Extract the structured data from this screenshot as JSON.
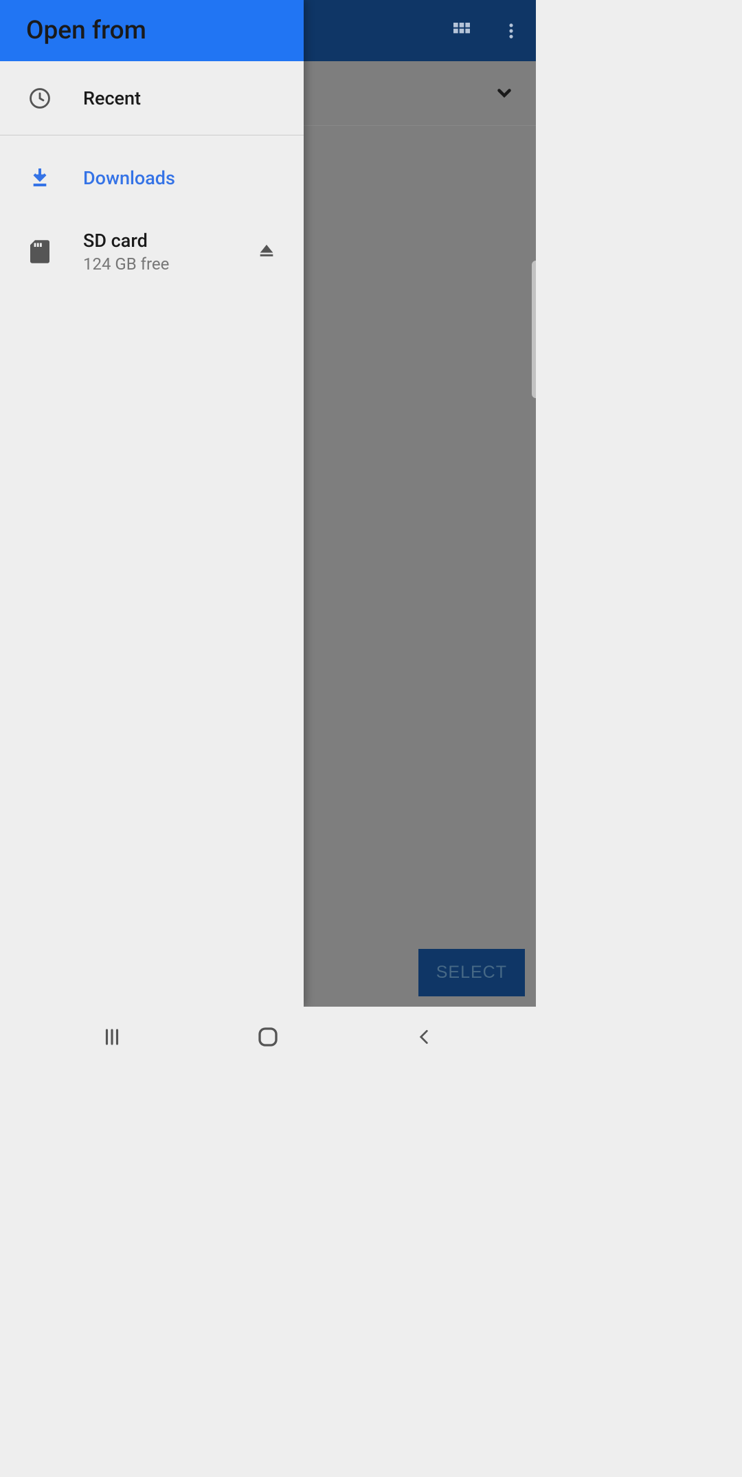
{
  "background": {
    "select_button": "SELECT"
  },
  "drawer": {
    "title": "Open from",
    "items": [
      {
        "label": "Recent",
        "icon": "clock"
      },
      {
        "label": "Downloads",
        "icon": "download",
        "active": true
      },
      {
        "label": "SD card",
        "sublabel": "124 GB free",
        "icon": "sd-card",
        "action": "eject"
      }
    ]
  },
  "colors": {
    "accent": "#2175f3",
    "active_text": "#3573e6"
  }
}
